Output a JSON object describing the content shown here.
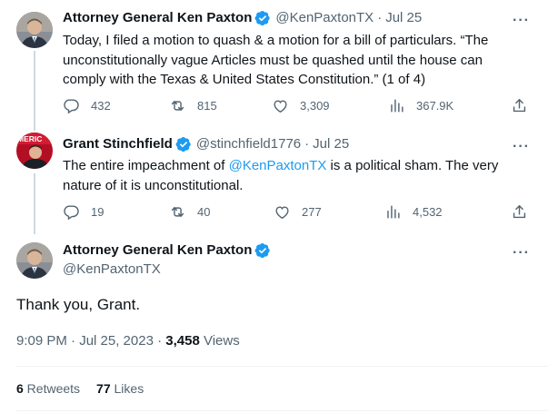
{
  "tweet1": {
    "name": "Attorney General Ken Paxton",
    "handle": "@KenPaxtonTX",
    "date": "Jul 25",
    "text": "Today, I filed a motion to quash & a motion for a bill of particulars. “The unconstitutionally vague Articles must be quashed until the house can comply with the Texas & United States Constitution.” (1 of 4)",
    "replies": "432",
    "retweets": "815",
    "likes": "3,309",
    "views": "367.9K"
  },
  "tweet2": {
    "name": "Grant Stinchfield",
    "handle": "@stinchfield1776",
    "date": "Jul 25",
    "avatar_text": "MERIC",
    "text_before": "The entire impeachment of ",
    "mention": "@KenPaxtonTX",
    "text_after": " is a political sham. The very nature of it is unconstitutional.",
    "replies": "19",
    "retweets": "40",
    "likes": "277",
    "views": "4,532"
  },
  "main": {
    "name": "Attorney General Ken Paxton",
    "handle": "@KenPaxtonTX",
    "text": "Thank you, Grant.",
    "time": "9:09 PM · Jul 25, 2023 · ",
    "views_count": "3,458",
    "views_label": " Views",
    "retweets_count": "6",
    "retweets_label": " Retweets",
    "likes_count": "77",
    "likes_label": " Likes"
  },
  "separator": "·",
  "more_glyph": "···",
  "icons": {
    "verified": "verified-badge-icon",
    "reply": "reply-icon",
    "retweet": "retweet-icon",
    "like": "heart-icon",
    "views": "views-bar-chart-icon",
    "share": "share-icon",
    "more": "more-options-icon"
  },
  "colors": {
    "accent": "#1d9bf0",
    "text": "#0f1419",
    "secondary": "#536471",
    "line": "#cfd9de",
    "grant_avatar": "#c8102e"
  }
}
